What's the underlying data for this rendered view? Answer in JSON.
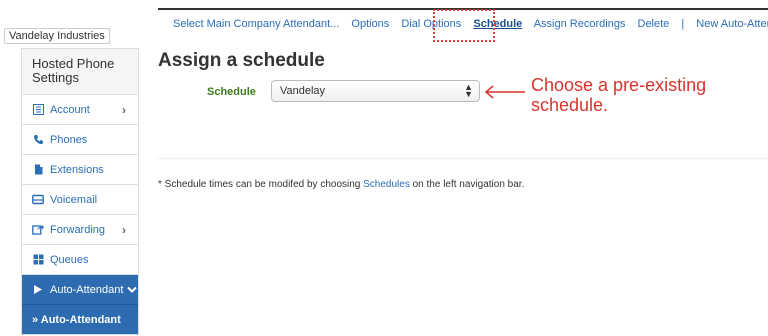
{
  "company": "Vandelay Industries",
  "sidebar": {
    "header": "Hosted Phone Settings",
    "items": [
      {
        "label": "Account",
        "icon": "list-icon",
        "chevron": "›"
      },
      {
        "label": "Phones",
        "icon": "phone-icon"
      },
      {
        "label": "Extensions",
        "icon": "document-icon"
      },
      {
        "label": "Voicemail",
        "icon": "voicemail-icon"
      },
      {
        "label": "Forwarding",
        "icon": "forward-icon",
        "chevron": "›"
      },
      {
        "label": "Queues",
        "icon": "grid-icon"
      },
      {
        "label": "Auto-Attendant",
        "icon": "play-icon"
      },
      {
        "label": "» Auto-Attendant"
      }
    ]
  },
  "topnav": {
    "select_main": "Select Main Company Attendant...",
    "options": "Options",
    "dial_options": "Dial Options",
    "schedule": "Schedule",
    "assign_recordings": "Assign Recordings",
    "delete": "Delete",
    "separator": "|",
    "new_auto_attendant": "New Auto-Attendant"
  },
  "main": {
    "title": "Assign a schedule",
    "schedule_label": "Schedule",
    "schedule_value": "Vandelay",
    "annotation": "Choose a pre-existing schedule.",
    "note_prefix": "* Schedule times can be modifed by choosing ",
    "note_link": "Schedules",
    "note_suffix": " on the left navigation bar."
  },
  "colors": {
    "accent": "#2d6cb0",
    "label_green": "#3d7b21",
    "annotation_red": "#d9342b"
  }
}
